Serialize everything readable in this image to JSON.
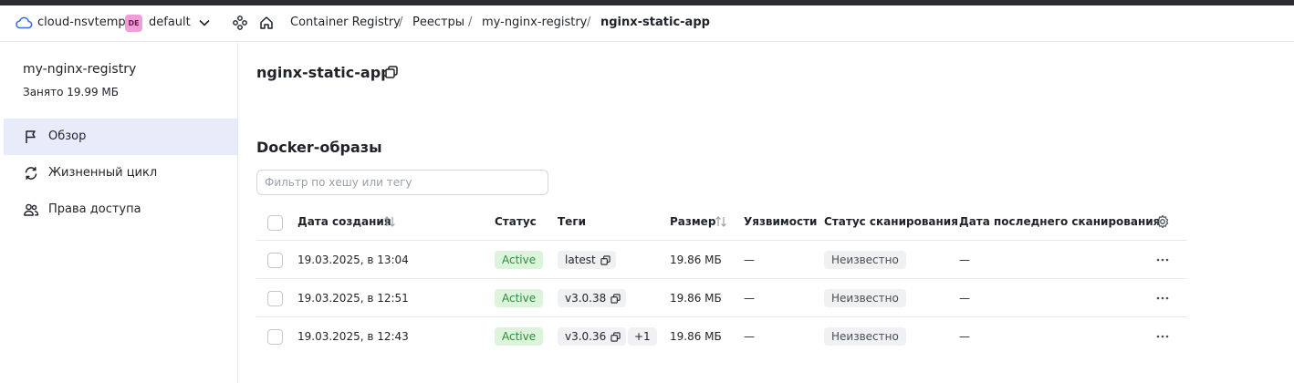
{
  "header": {
    "cloud_name": "cloud-nsvtemp",
    "folder_badge": "DE",
    "folder_name": "default",
    "breadcrumbs": [
      "Container Registry",
      "Реестры",
      "my-nginx-registry",
      "nginx-static-app"
    ],
    "separator": "/"
  },
  "sidebar": {
    "title": "my-nginx-registry",
    "subtitle": "Занято 19.99 МБ",
    "items": [
      {
        "label": "Обзор",
        "icon": "flag-icon",
        "active": true
      },
      {
        "label": "Жизненный цикл",
        "icon": "refresh-icon",
        "active": false
      },
      {
        "label": "Права доступа",
        "icon": "users-icon",
        "active": false
      }
    ]
  },
  "main": {
    "title": "nginx-static-app",
    "section_title": "Docker-образы",
    "filter_placeholder": "Фильтр по хешу или тегу",
    "columns": {
      "created": "Дата создания",
      "status": "Статус",
      "tags": "Теги",
      "size": "Размер",
      "vulns": "Уязвимости",
      "scan_status": "Статус сканирования",
      "last_scan": "Дата последнего сканирования"
    },
    "rows": [
      {
        "created": "19.03.2025, в 13:04",
        "status": "Active",
        "tag": "latest",
        "extra": "",
        "size": "19.86 МБ",
        "vulns": "—",
        "scan_status": "Неизвестно",
        "last_scan": "—"
      },
      {
        "created": "19.03.2025, в 12:51",
        "status": "Active",
        "tag": "v3.0.38",
        "extra": "",
        "size": "19.86 МБ",
        "vulns": "—",
        "scan_status": "Неизвестно",
        "last_scan": "—"
      },
      {
        "created": "19.03.2025, в 12:43",
        "status": "Active",
        "tag": "v3.0.36",
        "extra": "+1",
        "size": "19.86 МБ",
        "vulns": "—",
        "scan_status": "Неизвестно",
        "last_scan": "—"
      }
    ]
  },
  "colors": {
    "accent": "#e7ebfa",
    "status_active_bg": "#dcf4dc",
    "status_active_text": "#2e8b3a"
  }
}
